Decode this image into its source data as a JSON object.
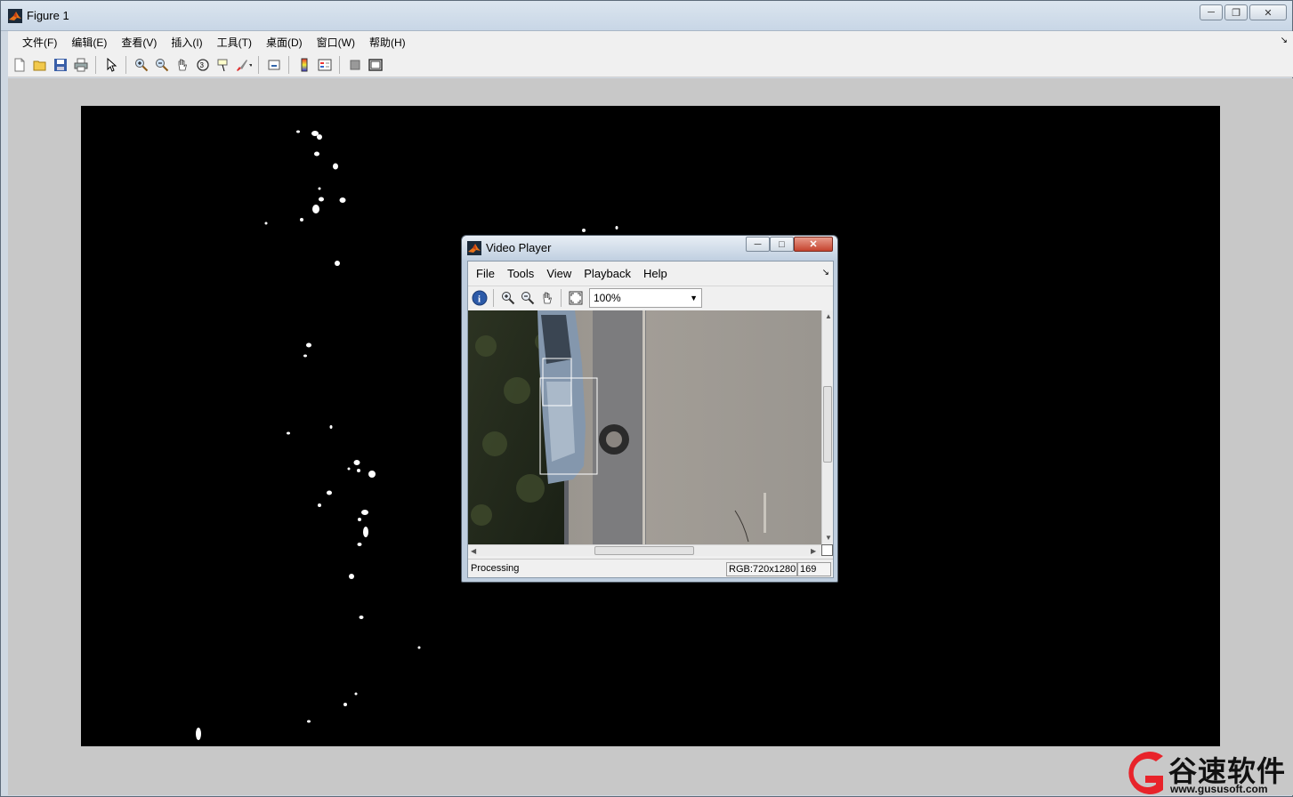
{
  "figure": {
    "title": "Figure 1",
    "window_buttons": [
      "minimize-icon",
      "restore-icon",
      "close-icon"
    ],
    "menu": [
      "文件(F)",
      "编辑(E)",
      "查看(V)",
      "插入(I)",
      "工具(T)",
      "桌面(D)",
      "窗口(W)",
      "帮助(H)"
    ],
    "toolbar_icons": [
      "new-figure-icon",
      "open-file-icon",
      "save-icon",
      "print-icon",
      "edit-plot-arrow-icon",
      "zoom-in-icon",
      "zoom-out-icon",
      "pan-hand-icon",
      "rotate-3d-icon",
      "data-cursor-icon",
      "brush-icon",
      "link-plot-icon",
      "colorbar-icon",
      "legend-icon",
      "hide-plot-tools-icon",
      "show-plot-tools-icon"
    ],
    "axes_background": "#000000",
    "blob_color": "#ffffff"
  },
  "video_player": {
    "title": "Video Player",
    "menu": [
      "File",
      "Tools",
      "View",
      "Playback",
      "Help"
    ],
    "toolbar_icons": [
      "info-icon",
      "zoom-in-icon",
      "zoom-out-icon",
      "pan-hand-icon",
      "fit-to-window-icon"
    ],
    "zoom_value": "100%",
    "status_text": "Processing",
    "image_info": "RGB:720x1280",
    "frame_number": "169"
  },
  "watermark": {
    "brand_cn": "谷速软件",
    "url": "www.gususoft.com",
    "brand_color": "#e8232a"
  }
}
